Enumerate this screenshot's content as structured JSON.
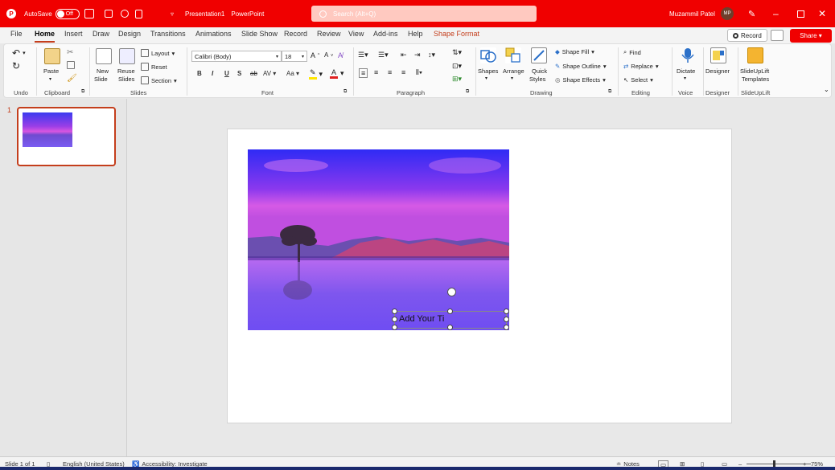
{
  "titlebar": {
    "autosave_label": "AutoSave",
    "autosave_state": "Off",
    "doc_title": "Presentation1",
    "app_name": "PowerPoint",
    "search_placeholder": "Search (Alt+Q)",
    "user_name": "Muzammil Patel",
    "user_initials": "MP",
    "minimize": "–",
    "close": "✕"
  },
  "menu": {
    "tabs": [
      "File",
      "Home",
      "Insert",
      "Draw",
      "Design",
      "Transitions",
      "Animations",
      "Slide Show",
      "Record",
      "Review",
      "View",
      "Add-ins",
      "Help",
      "Shape Format"
    ],
    "active_tab": "Home",
    "record_label": "Record",
    "share_label": "Share"
  },
  "ribbon": {
    "groups": {
      "undo": "Undo",
      "clipboard": "Clipboard",
      "slides": "Slides",
      "font": "Font",
      "paragraph": "Paragraph",
      "drawing": "Drawing",
      "editing": "Editing",
      "voice": "Voice",
      "designer": "Designer",
      "slideuplift": "SlideUpLift"
    },
    "clipboard": {
      "paste": "Paste"
    },
    "slides": {
      "new_slide_1": "New",
      "new_slide_2": "Slide",
      "reuse_1": "Reuse",
      "reuse_2": "Slides",
      "layout": "Layout",
      "reset": "Reset",
      "section": "Section"
    },
    "font": {
      "name": "Calibri (Body)",
      "size": "18",
      "bold": "B",
      "italic": "I",
      "underline": "U",
      "strike": "S"
    },
    "drawing": {
      "shapes": "Shapes",
      "arrange": "Arrange",
      "quick_styles_1": "Quick",
      "quick_styles_2": "Styles",
      "shape_fill": "Shape Fill",
      "shape_outline": "Shape Outline",
      "shape_effects": "Shape Effects"
    },
    "editing": {
      "find": "Find",
      "replace": "Replace",
      "select": "Select"
    },
    "voice": {
      "dictate": "Dictate"
    },
    "designer": {
      "designer": "Designer"
    },
    "slideuplift": {
      "templates_1": "SlideUpLift",
      "templates_2": "Templates"
    }
  },
  "thumbnails": {
    "slide_number": "1"
  },
  "slide": {
    "title_placeholder_text": "Add Your Ti"
  },
  "status": {
    "slide_count": "Slide 1 of 1",
    "language": "English (United States)",
    "accessibility": "Accessibility: Investigate",
    "notes": "Notes",
    "zoom": "75%"
  },
  "colors": {
    "brand": "#f00000",
    "accent": "#c43e1c"
  }
}
